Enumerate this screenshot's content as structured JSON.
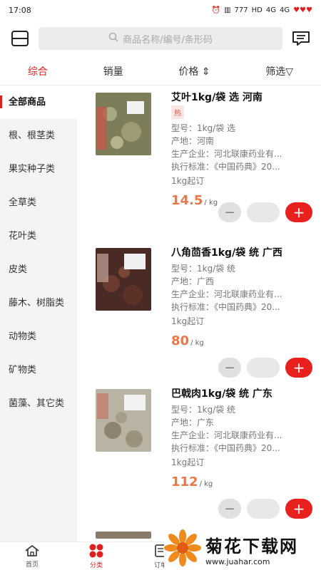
{
  "status": {
    "time": "17:08",
    "net1": "4G",
    "net2": "4G",
    "hd": "HD",
    "speed": "777"
  },
  "search": {
    "placeholder": "商品名称/编号/条形码"
  },
  "sort": {
    "tabs": [
      "综合",
      "销量",
      "价格 ⇕",
      "筛选▽"
    ],
    "active": 0
  },
  "categories": [
    "全部商品",
    "根、根茎类",
    "果实种子类",
    "全草类",
    "花叶类",
    "皮类",
    "藤木、树脂类",
    "动物类",
    "矿物类",
    "菌藻、其它类"
  ],
  "products": [
    {
      "name": "艾叶1kg/袋 选 河南",
      "badge": "热",
      "model": "型号：1kg/袋 选",
      "origin": "产地：河南",
      "maker": "生产企业：河北联康药业有...",
      "standard": "执行标准：《中国药典》20...",
      "moq": "1kg起订",
      "price": "14.5",
      "unit": "/ kg"
    },
    {
      "name": "八角茴香1kg/袋 统 广西",
      "badge": "",
      "model": "型号：1kg/袋 统",
      "origin": "产地：广西",
      "maker": "生产企业：河北联康药业有...",
      "standard": "执行标准：《中国药典》20...",
      "moq": "1kg起订",
      "price": "80",
      "unit": "/ kg"
    },
    {
      "name": "巴戟肉1kg/袋 统 广东",
      "badge": "",
      "model": "型号：1kg/袋 统",
      "origin": "产地：广东",
      "maker": "生产企业：河北联康药业有...",
      "standard": "执行标准：《中国药典》20...",
      "moq": "1kg起订",
      "price": "112",
      "unit": "/ kg"
    }
  ],
  "nav": [
    {
      "label": "首页",
      "icon": "home-icon"
    },
    {
      "label": "分类",
      "icon": "category-icon"
    },
    {
      "label": "订单",
      "icon": "order-icon"
    }
  ],
  "watermark": {
    "title": "菊花下载网",
    "url": "www.juahar.com"
  },
  "colors": {
    "accent": "#e02020",
    "price": "#e8774a",
    "plus": "#e8201e"
  }
}
